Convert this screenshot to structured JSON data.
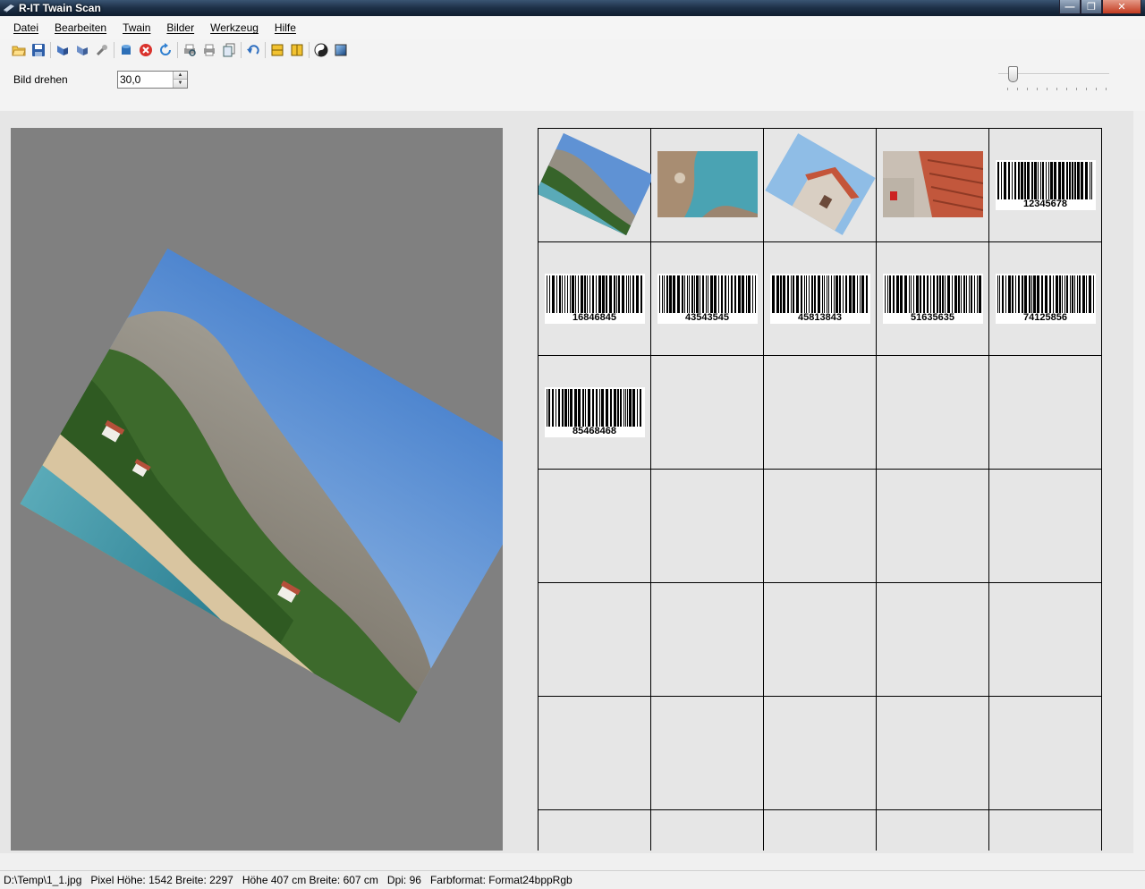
{
  "window": {
    "title": "R-IT Twain Scan"
  },
  "menu": [
    "Datei",
    "Bearbeiten",
    "Twain",
    "Bilder",
    "Werkzeug",
    "Hilfe"
  ],
  "toolbar": {
    "icons": [
      "open-folder-icon",
      "save-icon",
      "scanner-icon",
      "scanner-alt-icon",
      "tool-icon",
      "cylinder-icon",
      "stop-icon",
      "refresh-icon",
      "printer-preview-icon",
      "printer-icon",
      "multi-page-icon",
      "undo-icon",
      "fit-width-icon",
      "fit-height-icon",
      "yin-yang-icon",
      "gradient-icon"
    ]
  },
  "options": {
    "rotate_label": "Bild drehen",
    "rotate_value": "30,0",
    "slider_level": 0.1
  },
  "thumbnails": {
    "columns": 5,
    "rows_visible": 7,
    "photos": [
      "photo-coast-hillside",
      "photo-sea-rocks",
      "photo-house-roof",
      "photo-roof-tiles"
    ],
    "barcodes": [
      "12345678",
      "16846845",
      "43543545",
      "45813843",
      "51635635",
      "74125856",
      "85468468"
    ]
  },
  "status": {
    "path": "D:\\Temp\\1_1.jpg",
    "pixels": "Pixel Höhe: 1542 Breite: 2297",
    "size_cm": "Höhe 407 cm Breite: 607 cm",
    "dpi": "Dpi: 96",
    "color_format": "Farbformat: Format24bppRgb"
  },
  "colors": {
    "titlebar": "#1d3047",
    "preview_bg": "#808080",
    "workarea_bg": "#e6e6e6"
  }
}
